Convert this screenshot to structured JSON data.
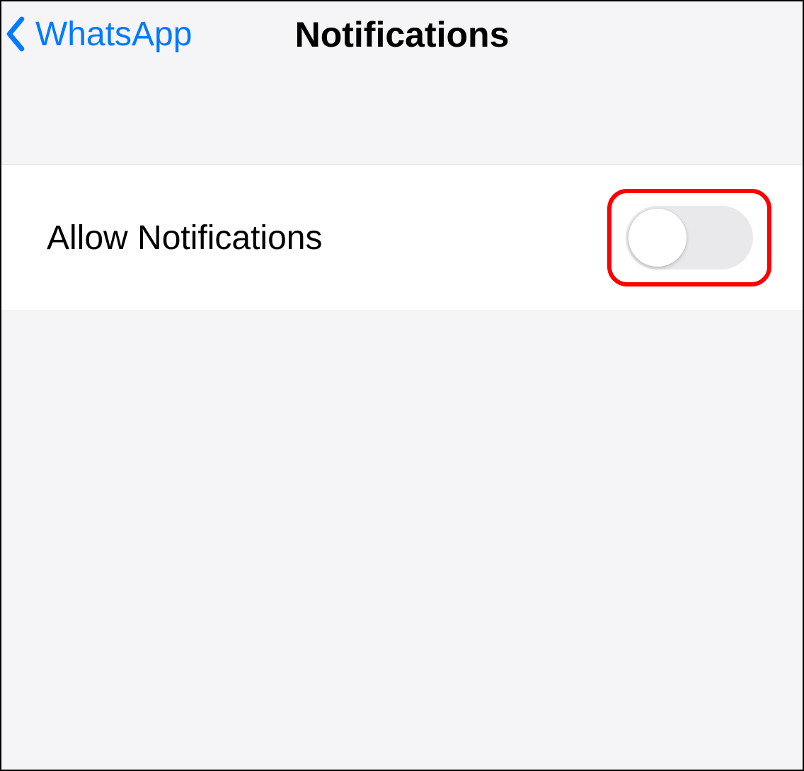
{
  "nav": {
    "back_label": "WhatsApp",
    "title": "Notifications"
  },
  "settings": {
    "allow_notifications": {
      "label": "Allow Notifications",
      "value": false
    }
  },
  "annotation": {
    "highlight_color": "#ff0000"
  }
}
